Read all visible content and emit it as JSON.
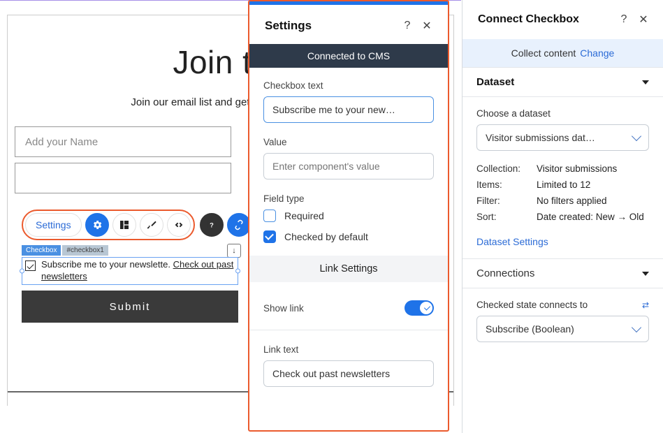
{
  "canvas": {
    "form_title": "Join the",
    "form_subtitle": "Join our email list and get access to specia",
    "name_placeholder": "Add your Name",
    "tag1": "Checkbox",
    "tag2": "#checkbox1",
    "checkbox_text_a": "Subscribe me to your newslette",
    "checkbox_text_b": "Check out past newsletters",
    "submit": "Submit"
  },
  "toolbar": {
    "settings_label": "Settings"
  },
  "settings": {
    "title": "Settings",
    "connected_band": "Connected to CMS",
    "checkbox_text_label": "Checkbox text",
    "checkbox_text_value": "Subscribe me to your new…",
    "value_label": "Value",
    "value_placeholder": "Enter component's value",
    "field_type_label": "Field type",
    "required_label": "Required",
    "checked_default_label": "Checked by default",
    "link_settings_bar": "Link Settings",
    "show_link_label": "Show link",
    "link_text_label": "Link text",
    "link_text_value": "Check out past newsletters"
  },
  "connect": {
    "title": "Connect Checkbox",
    "collect_label": "Collect content",
    "change_link": "Change",
    "dataset_head": "Dataset",
    "choose_dataset_label": "Choose a dataset",
    "dataset_value": "Visitor submissions dat…",
    "meta": {
      "collection_k": "Collection:",
      "collection_v": "Visitor submissions",
      "items_k": "Items:",
      "items_v": "Limited to 12",
      "filter_k": "Filter:",
      "filter_v": "No filters applied",
      "sort_k": "Sort:",
      "sort_v": "Date created: New → Old"
    },
    "dataset_settings_link": "Dataset Settings",
    "connections_head": "Connections",
    "checked_state_label": "Checked state connects to",
    "checked_state_value": "Subscribe (Boolean)"
  }
}
